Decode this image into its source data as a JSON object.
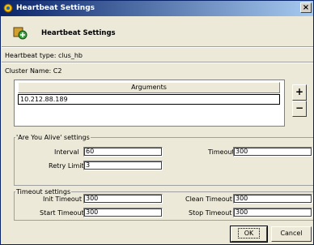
{
  "window": {
    "title": "Heartbeat Settings"
  },
  "header": {
    "title": "Heartbeat Settings"
  },
  "info": {
    "heartbeat_type": "Heartbeat type: clus_hb",
    "cluster_name": "Cluster Name: C2"
  },
  "arguments": {
    "header": "Arguments",
    "rows": [
      "10.212.88.189"
    ],
    "add_label": "+",
    "remove_label": "−"
  },
  "are_you_alive": {
    "legend": "'Are You Alive' settings",
    "interval_label": "Interval",
    "interval_value": "60",
    "timeout_label": "Timeout",
    "timeout_value": "300",
    "retry_label": "Retry Limit",
    "retry_value": "3"
  },
  "timeout_settings": {
    "legend": "Timeout settings",
    "init_label": "Init Timeout",
    "init_value": "300",
    "clean_label": "Clean Timeout",
    "clean_value": "300",
    "start_label": "Start Timeout",
    "start_value": "300",
    "stop_label": "Stop Timeout",
    "stop_value": "300"
  },
  "buttons": {
    "ok": "OK",
    "cancel": "Cancel"
  },
  "icons": {
    "title": "heartbeat-app-icon",
    "header": "heartbeat-settings-icon",
    "close": "close-icon"
  },
  "colors": {
    "titlebar_start": "#0a246a",
    "titlebar_end": "#a6caf0",
    "dialog_bg": "#ece9d8"
  }
}
